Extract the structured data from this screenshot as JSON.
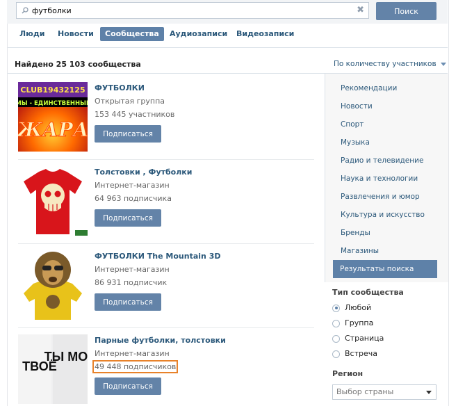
{
  "search": {
    "value": "футболки",
    "button_label": "Поиск"
  },
  "tabs": [
    {
      "label": "Люди"
    },
    {
      "label": "Новости"
    },
    {
      "label": "Сообщества"
    },
    {
      "label": "Аудиозаписи"
    },
    {
      "label": "Видеозаписи"
    }
  ],
  "results_header": {
    "found_text": "Найдено 25 103 сообщества",
    "sort_label": "По количеству участников"
  },
  "results": [
    {
      "title": "ФУТБОЛКИ",
      "type": "Открытая группа",
      "members": "153 445 участников",
      "button": "Подписаться",
      "thumb_text_top": "CLUB19432125",
      "thumb_text_mid": "МЫ - ЕДИНСТВЕННЫЕ",
      "thumb_text_big": "ЖАРА"
    },
    {
      "title": "Толстовки , Футболки",
      "type": "Интернет-магазин",
      "members": "64 963 подписчика",
      "button": "Подписаться"
    },
    {
      "title": "ФУТБОЛКИ The Mountain 3D",
      "type": "Интернет-магазин",
      "members": "86 931 подписчик",
      "button": "Подписаться"
    },
    {
      "title": "Парные футболки, толстовки",
      "type": "Интернет-магазин",
      "members": "49 448 подписчиков",
      "button": "Подписаться",
      "thumb_text_left": "Я ТВОЁ",
      "thumb_text_right": "ТЫ МОЁ"
    }
  ],
  "sidebar": {
    "items": [
      {
        "label": "Рекомендации"
      },
      {
        "label": "Новости"
      },
      {
        "label": "Спорт"
      },
      {
        "label": "Музыка"
      },
      {
        "label": "Радио и телевидение"
      },
      {
        "label": "Наука и технологии"
      },
      {
        "label": "Развлечения и юмор"
      },
      {
        "label": "Культура и искусство"
      },
      {
        "label": "Бренды"
      },
      {
        "label": "Магазины"
      },
      {
        "label": "Результаты поиска"
      }
    ],
    "type_title": "Тип сообщества",
    "types": [
      {
        "label": "Любой",
        "checked": true
      },
      {
        "label": "Группа",
        "checked": false
      },
      {
        "label": "Страница",
        "checked": false
      },
      {
        "label": "Встреча",
        "checked": false
      }
    ],
    "region_title": "Регион",
    "region_select": "Выбор страны"
  },
  "colors": {
    "accent": "#5e81a8",
    "link": "#2b587a",
    "highlight": "#e8822a"
  }
}
